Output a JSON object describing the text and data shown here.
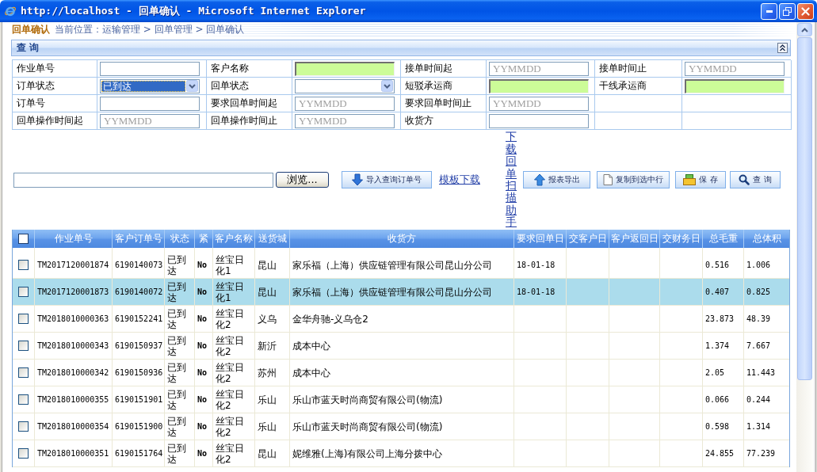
{
  "window": {
    "title": "http://localhost - 回单确认 - Microsoft Internet Explorer"
  },
  "breadcrumb": {
    "page_title": "回单确认",
    "location": "当前位置：运输管理 > 回单管理 > 回单确认"
  },
  "query": {
    "title": "查 询",
    "rows": [
      [
        {
          "label": "作业单号",
          "kind": "text"
        },
        {
          "label": "客户名称",
          "kind": "lookup"
        },
        {
          "label": "接单时间起",
          "kind": "text",
          "placeholder": "YYMMDD"
        },
        {
          "label": "接单时间止",
          "kind": "text",
          "placeholder": "YYMMDD"
        }
      ],
      [
        {
          "label": "订单状态",
          "kind": "select",
          "value": "已到达",
          "focused": true
        },
        {
          "label": "回单状态",
          "kind": "select",
          "focused": false
        },
        {
          "label": "短驳承运商",
          "kind": "lookup"
        },
        {
          "label": "干线承运商",
          "kind": "lookup"
        }
      ],
      [
        {
          "label": "订单号",
          "kind": "text"
        },
        {
          "label": "要求回单时间起",
          "kind": "text",
          "placeholder": "YYMMDD"
        },
        {
          "label": "要求回单时间止",
          "kind": "text",
          "placeholder": "YYMMDD"
        }
      ],
      [
        {
          "label": "回单操作时间起",
          "kind": "text",
          "placeholder": "YYMMDD"
        },
        {
          "label": "回单操作时间止",
          "kind": "text",
          "placeholder": "YYMMDD"
        },
        {
          "label": "收货方",
          "kind": "text"
        }
      ]
    ]
  },
  "toolbar": {
    "browse_button": "浏览...",
    "items": [
      {
        "kind": "button",
        "label": "导入查询订单号"
      },
      {
        "kind": "link",
        "label": "模板下载"
      },
      {
        "kind": "vertical_link",
        "label": "下载回单扫描助手"
      },
      {
        "kind": "button",
        "label": "报表导出"
      },
      {
        "kind": "button",
        "label": "复制到选中行"
      },
      {
        "kind": "button",
        "label": "保 存"
      },
      {
        "kind": "button",
        "label": "查 询"
      }
    ]
  },
  "table": {
    "select_all": {
      "checked": false
    },
    "columns": [
      "作业单号",
      "客户订单号",
      "状态",
      "紧",
      "客户名称",
      "送货城",
      "收货方",
      "要求回单日",
      "交客户日",
      "客户返回日",
      "交财务日",
      "总毛重",
      "总体积"
    ],
    "rows": [
      {
        "selected": false,
        "checked": false,
        "job_no": "TM2017120001874",
        "customer_order_no": "6190140073",
        "status": "已到达",
        "urgent": "No",
        "customer": "丝宝日化1",
        "city": "昆山",
        "consignee": "家乐福（上海）供应链管理有限公司昆山分公司",
        "required_return_date": "18-01-18",
        "gross_weight": "0.516",
        "volume": "1.006"
      },
      {
        "selected": true,
        "checked": false,
        "job_no": "TM2017120001873",
        "customer_order_no": "6190140072",
        "status": "已到达",
        "urgent": "No",
        "customer": "丝宝日化1",
        "city": "昆山",
        "consignee": "家乐福（上海）供应链管理有限公司昆山分公司",
        "required_return_date": "18-01-18",
        "gross_weight": "0.407",
        "volume": "0.825"
      },
      {
        "selected": false,
        "checked": false,
        "job_no": "TM2018010000363",
        "customer_order_no": "6190152241",
        "status": "已到达",
        "urgent": "No",
        "customer": "丝宝日化2",
        "city": "义乌",
        "consignee": "金华舟驰-义乌仓2",
        "gross_weight": "23.873",
        "volume": "48.39"
      },
      {
        "selected": false,
        "checked": false,
        "job_no": "TM2018010000343",
        "customer_order_no": "6190150937",
        "status": "已到达",
        "urgent": "No",
        "customer": "丝宝日化2",
        "city": "新沂",
        "consignee": "成本中心",
        "gross_weight": "1.374",
        "volume": "7.667"
      },
      {
        "selected": false,
        "checked": false,
        "job_no": "TM2018010000342",
        "customer_order_no": "6190150936",
        "status": "已到达",
        "urgent": "No",
        "customer": "丝宝日化2",
        "city": "苏州",
        "consignee": "成本中心",
        "gross_weight": "2.05",
        "volume": "11.443"
      },
      {
        "selected": false,
        "checked": false,
        "job_no": "TM2018010000355",
        "customer_order_no": "6190151901",
        "status": "已到达",
        "urgent": "No",
        "customer": "丝宝日化2",
        "city": "乐山",
        "consignee": "乐山市蓝天时尚商贸有限公司(物流)",
        "gross_weight": "0.066",
        "volume": "0.244"
      },
      {
        "selected": false,
        "checked": false,
        "job_no": "TM2018010000354",
        "customer_order_no": "6190151900",
        "status": "已到达",
        "urgent": "No",
        "customer": "丝宝日化2",
        "city": "乐山",
        "consignee": "乐山市蓝天时尚商贸有限公司(物流)",
        "gross_weight": "0.598",
        "volume": "1.314"
      },
      {
        "selected": false,
        "checked": false,
        "job_no": "TM2018010000351",
        "customer_order_no": "6190151764",
        "status": "已到达",
        "urgent": "No",
        "customer": "丝宝日化2",
        "city": "昆山",
        "consignee": "妮维雅(上海)有限公司上海分拨中心",
        "gross_weight": "24.855",
        "volume": "77.239"
      }
    ]
  }
}
